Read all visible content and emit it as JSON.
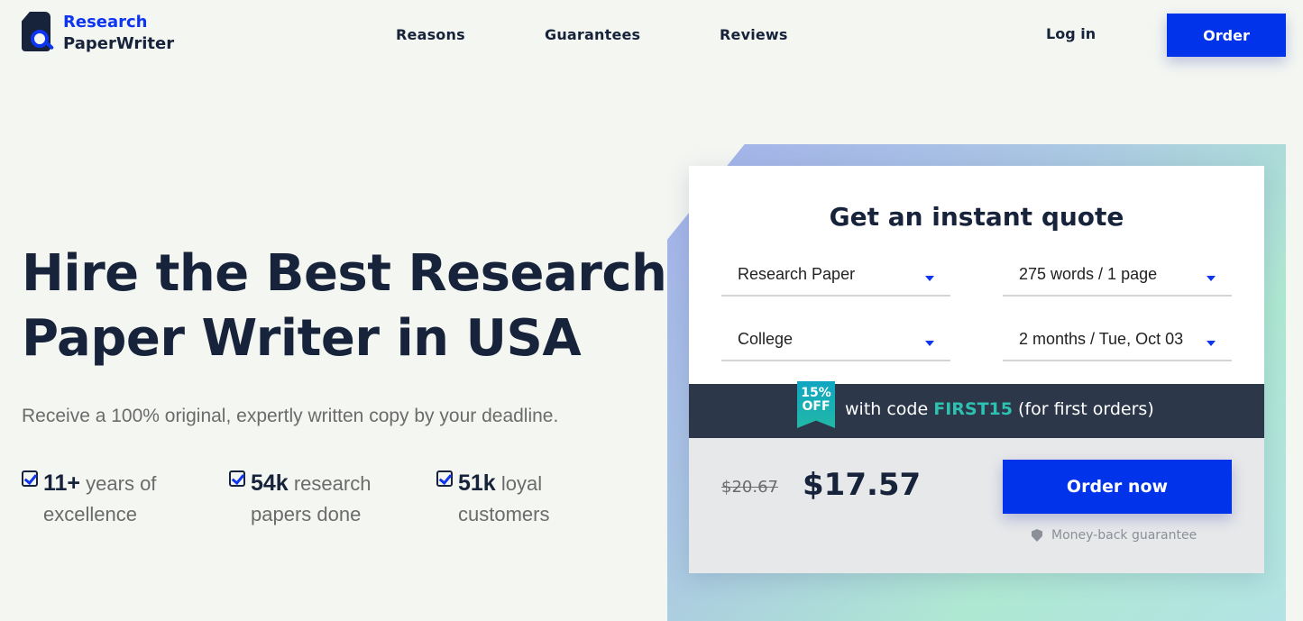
{
  "header": {
    "logo": {
      "line1": "Research",
      "line2": "PaperWriter",
      "icon": "magnifier-document-icon"
    },
    "nav": [
      {
        "label": "Reasons"
      },
      {
        "label": "Guarantees"
      },
      {
        "label": "Reviews"
      }
    ],
    "login_label": "Log in",
    "order_label": "Order"
  },
  "hero": {
    "title": "Hire the Best Research Paper Writer in USA",
    "subtitle": "Receive a 100% original, expertly written copy by your deadline.",
    "stats": [
      {
        "number": "11+",
        "text": "years of excellence",
        "icon": "checkbox-icon"
      },
      {
        "number": "54k",
        "text": "research papers done",
        "icon": "checkbox-icon"
      },
      {
        "number": "51k",
        "text": "loyal customers",
        "icon": "checkbox-icon"
      }
    ]
  },
  "quote": {
    "title": "Get an instant quote",
    "selects": {
      "paper_type": "Research Paper",
      "length": "275 words / 1 page",
      "level": "College",
      "deadline": "2 months / Tue, Oct 03"
    },
    "promo": {
      "ribbon_line1": "15%",
      "ribbon_line2": "OFF",
      "text_before": "with code ",
      "code": "FIRST15",
      "text_after": " (for first orders)"
    },
    "old_price": "$20.67",
    "new_price": "$17.57",
    "order_now_label": "Order now",
    "guarantee_label": "Money-back guarantee"
  },
  "colors": {
    "brand_blue": "#0033ea",
    "dark_navy": "#17233a",
    "promo_bg": "#2c3749",
    "promo_code": "#2ec1b1"
  }
}
